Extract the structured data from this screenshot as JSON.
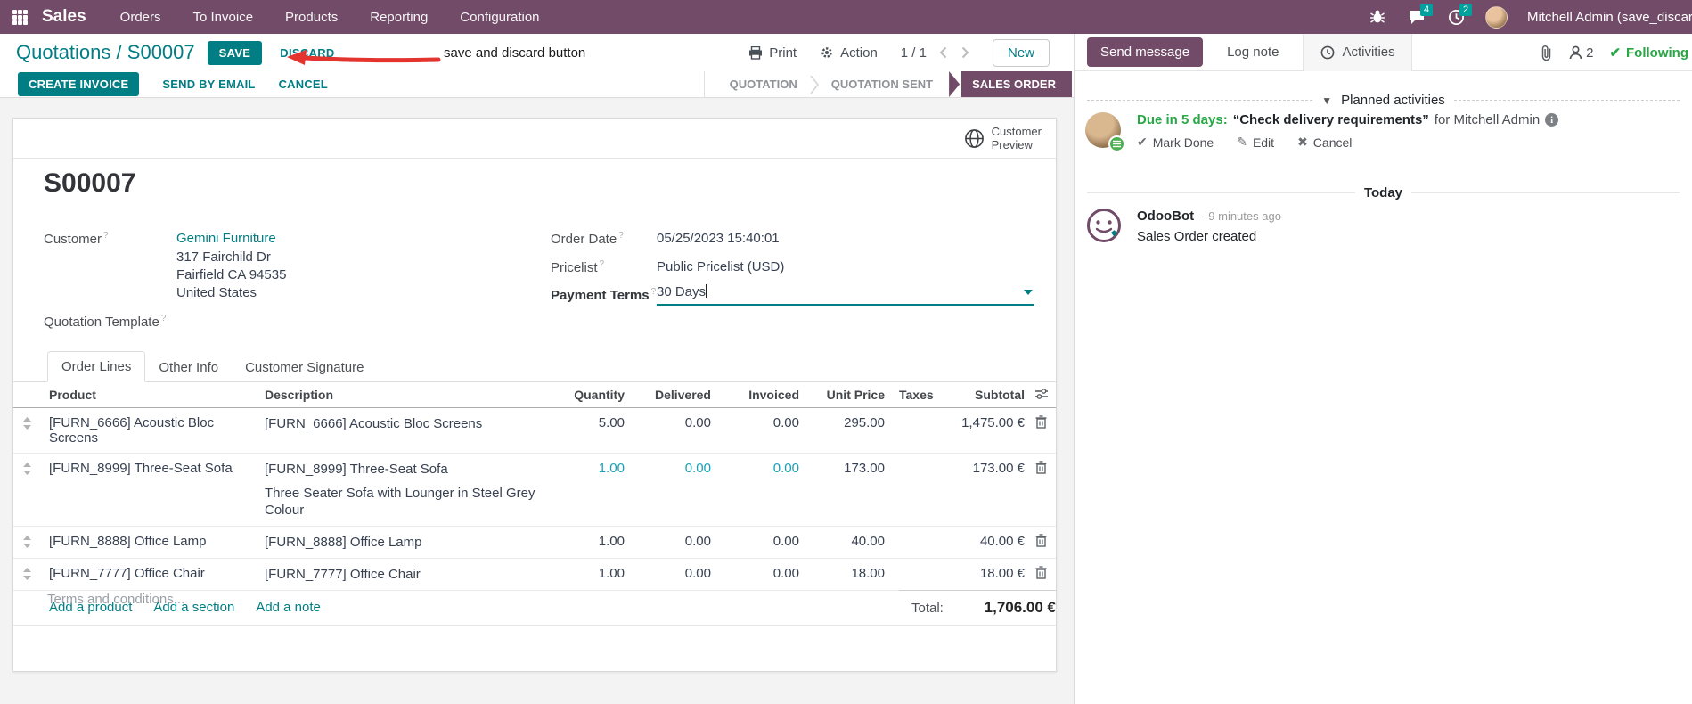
{
  "colors": {
    "brand_purple": "#714B67",
    "primary_teal": "#017E84",
    "badge_teal": "#00A09D",
    "info_blue": "#17A2B8",
    "green": "#28A745",
    "annotation_red": "#E3342F"
  },
  "topbar": {
    "app_name": "Sales",
    "menus": [
      "Orders",
      "To Invoice",
      "Products",
      "Reporting",
      "Configuration"
    ],
    "message_badge": "4",
    "activity_badge": "2",
    "user_name": "Mitchell Admin (save_discard"
  },
  "control_panel": {
    "breadcrumb_parent": "Quotations",
    "breadcrumb_sep": "/",
    "breadcrumb_current": "S00007",
    "save_label": "SAVE",
    "discard_label": "DISCARD",
    "print_label": "Print",
    "action_label": "Action",
    "pager": "1 / 1",
    "new_label": "New"
  },
  "annotation": {
    "text": "save and discard button"
  },
  "statusbar": {
    "create_invoice": "CREATE INVOICE",
    "send_by_email": "SEND BY EMAIL",
    "cancel": "CANCEL",
    "stage1": "QUOTATION",
    "stage2": "QUOTATION SENT",
    "stage_active": "SALES ORDER"
  },
  "sheet": {
    "preview_line1": "Customer",
    "preview_line2": "Preview",
    "title": "S00007",
    "help_marker": "?",
    "customer_label": "Customer",
    "customer_name": "Gemini Furniture",
    "address1": "317 Fairchild Dr",
    "address2": "Fairfield CA 94535",
    "address3": "United States",
    "quotation_template_label": "Quotation Template",
    "order_date_label": "Order Date",
    "order_date_value": "05/25/2023 15:40:01",
    "pricelist_label": "Pricelist",
    "pricelist_value": "Public Pricelist (USD)",
    "payment_terms_label": "Payment Terms",
    "payment_terms_value": "30 Days",
    "tab1": "Order Lines",
    "tab2": "Other Info",
    "tab3": "Customer Signature",
    "terms_placeholder": "Terms and conditions...",
    "total_label": "Total:",
    "total_value": "1,706.00 €"
  },
  "order_lines": {
    "headers": {
      "product": "Product",
      "description": "Description",
      "quantity": "Quantity",
      "delivered": "Delivered",
      "invoiced": "Invoiced",
      "unit_price": "Unit Price",
      "taxes": "Taxes",
      "subtotal": "Subtotal"
    },
    "rows": [
      {
        "product": "[FURN_6666] Acoustic Bloc Screens",
        "description": "[FURN_6666] Acoustic Bloc Screens",
        "description2": "",
        "qty": "5.00",
        "delivered": "0.00",
        "invoiced": "0.00",
        "unit_price": "295.00",
        "taxes": "",
        "subtotal": "1,475.00 €"
      },
      {
        "product": "[FURN_8999] Three-Seat Sofa",
        "description": "[FURN_8999] Three-Seat Sofa",
        "description2": "Three Seater Sofa with Lounger in Steel Grey Colour",
        "qty": "1.00",
        "delivered": "0.00",
        "invoiced": "0.00",
        "unit_price": "173.00",
        "taxes": "",
        "subtotal": "173.00 €"
      },
      {
        "product": "[FURN_8888] Office Lamp",
        "description": "[FURN_8888] Office Lamp",
        "description2": "",
        "qty": "1.00",
        "delivered": "0.00",
        "invoiced": "0.00",
        "unit_price": "40.00",
        "taxes": "",
        "subtotal": "40.00 €"
      },
      {
        "product": "[FURN_7777] Office Chair",
        "description": "[FURN_7777] Office Chair",
        "description2": "",
        "qty": "1.00",
        "delivered": "0.00",
        "invoiced": "0.00",
        "unit_price": "18.00",
        "taxes": "",
        "subtotal": "18.00 €"
      }
    ],
    "add_product": "Add a product",
    "add_section": "Add a section",
    "add_note": "Add a note"
  },
  "chatter": {
    "send_message": "Send message",
    "log_note": "Log note",
    "activities": "Activities",
    "follower_count": "2",
    "following": "Following",
    "planned_header": "Planned activities",
    "activity": {
      "due": "Due in 5 days:",
      "summary": "“Check delivery requirements”",
      "for_text": "for Mitchell Admin",
      "mark_done": "Mark Done",
      "edit": "Edit",
      "cancel": "Cancel"
    },
    "today": "Today",
    "message": {
      "author": "OdooBot",
      "time": "- 9 minutes ago",
      "body": "Sales Order created"
    }
  }
}
